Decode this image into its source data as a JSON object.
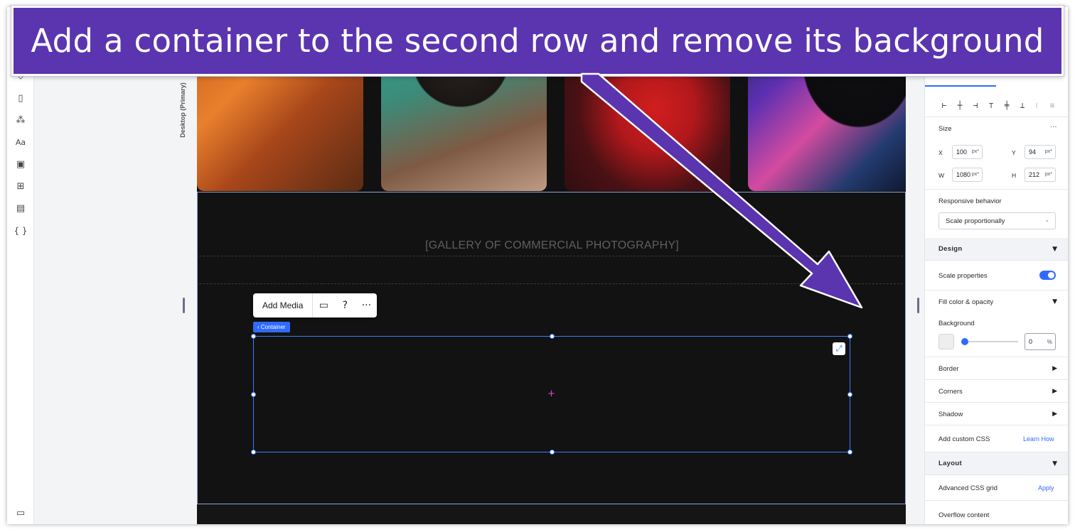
{
  "banner": {
    "text": "Add a container to the second row and remove its background"
  },
  "left_toolbar": {
    "icons": [
      "layers-icon",
      "pages-icon",
      "components-icon",
      "text-theme-icon",
      "media-icon",
      "apps-icon",
      "cms-table-icon",
      "code-icon",
      "chat-icon"
    ]
  },
  "workspace": {
    "breakpoint_label": "Desktop (Primary)"
  },
  "canvas": {
    "gallery_title": "[GALLERY OF COMMERCIAL PHOTOGRAPHY]",
    "floating_toolbar": {
      "add_media_label": "Add Media"
    },
    "container_tag": "‹ Container"
  },
  "panel": {
    "size": {
      "title": "Size",
      "more": "···",
      "x_label": "X",
      "x_value": "100",
      "x_unit": "px*",
      "y_label": "Y",
      "y_value": "94",
      "y_unit": "px*",
      "w_label": "W",
      "w_value": "1080",
      "w_unit": "px*",
      "h_label": "H",
      "h_value": "212",
      "h_unit": "px*"
    },
    "responsive": {
      "title": "Responsive behavior",
      "value": "Scale proportionally"
    },
    "design": {
      "title": "Design",
      "scale_properties": "Scale properties",
      "scale_properties_on": true,
      "fill": "Fill color & opacity",
      "background": "Background",
      "opacity_value": "0",
      "opacity_unit": "%",
      "border": "Border",
      "corners": "Corners",
      "shadow": "Shadow",
      "custom_css": "Add custom CSS",
      "learn_how": "Learn How"
    },
    "layout": {
      "title": "Layout",
      "css_grid": "Advanced CSS grid",
      "apply": "Apply",
      "overflow": "Overflow content"
    }
  },
  "colors": {
    "banner": "#5b34b0",
    "accent": "#2f6bff",
    "canvas": "#121212"
  }
}
